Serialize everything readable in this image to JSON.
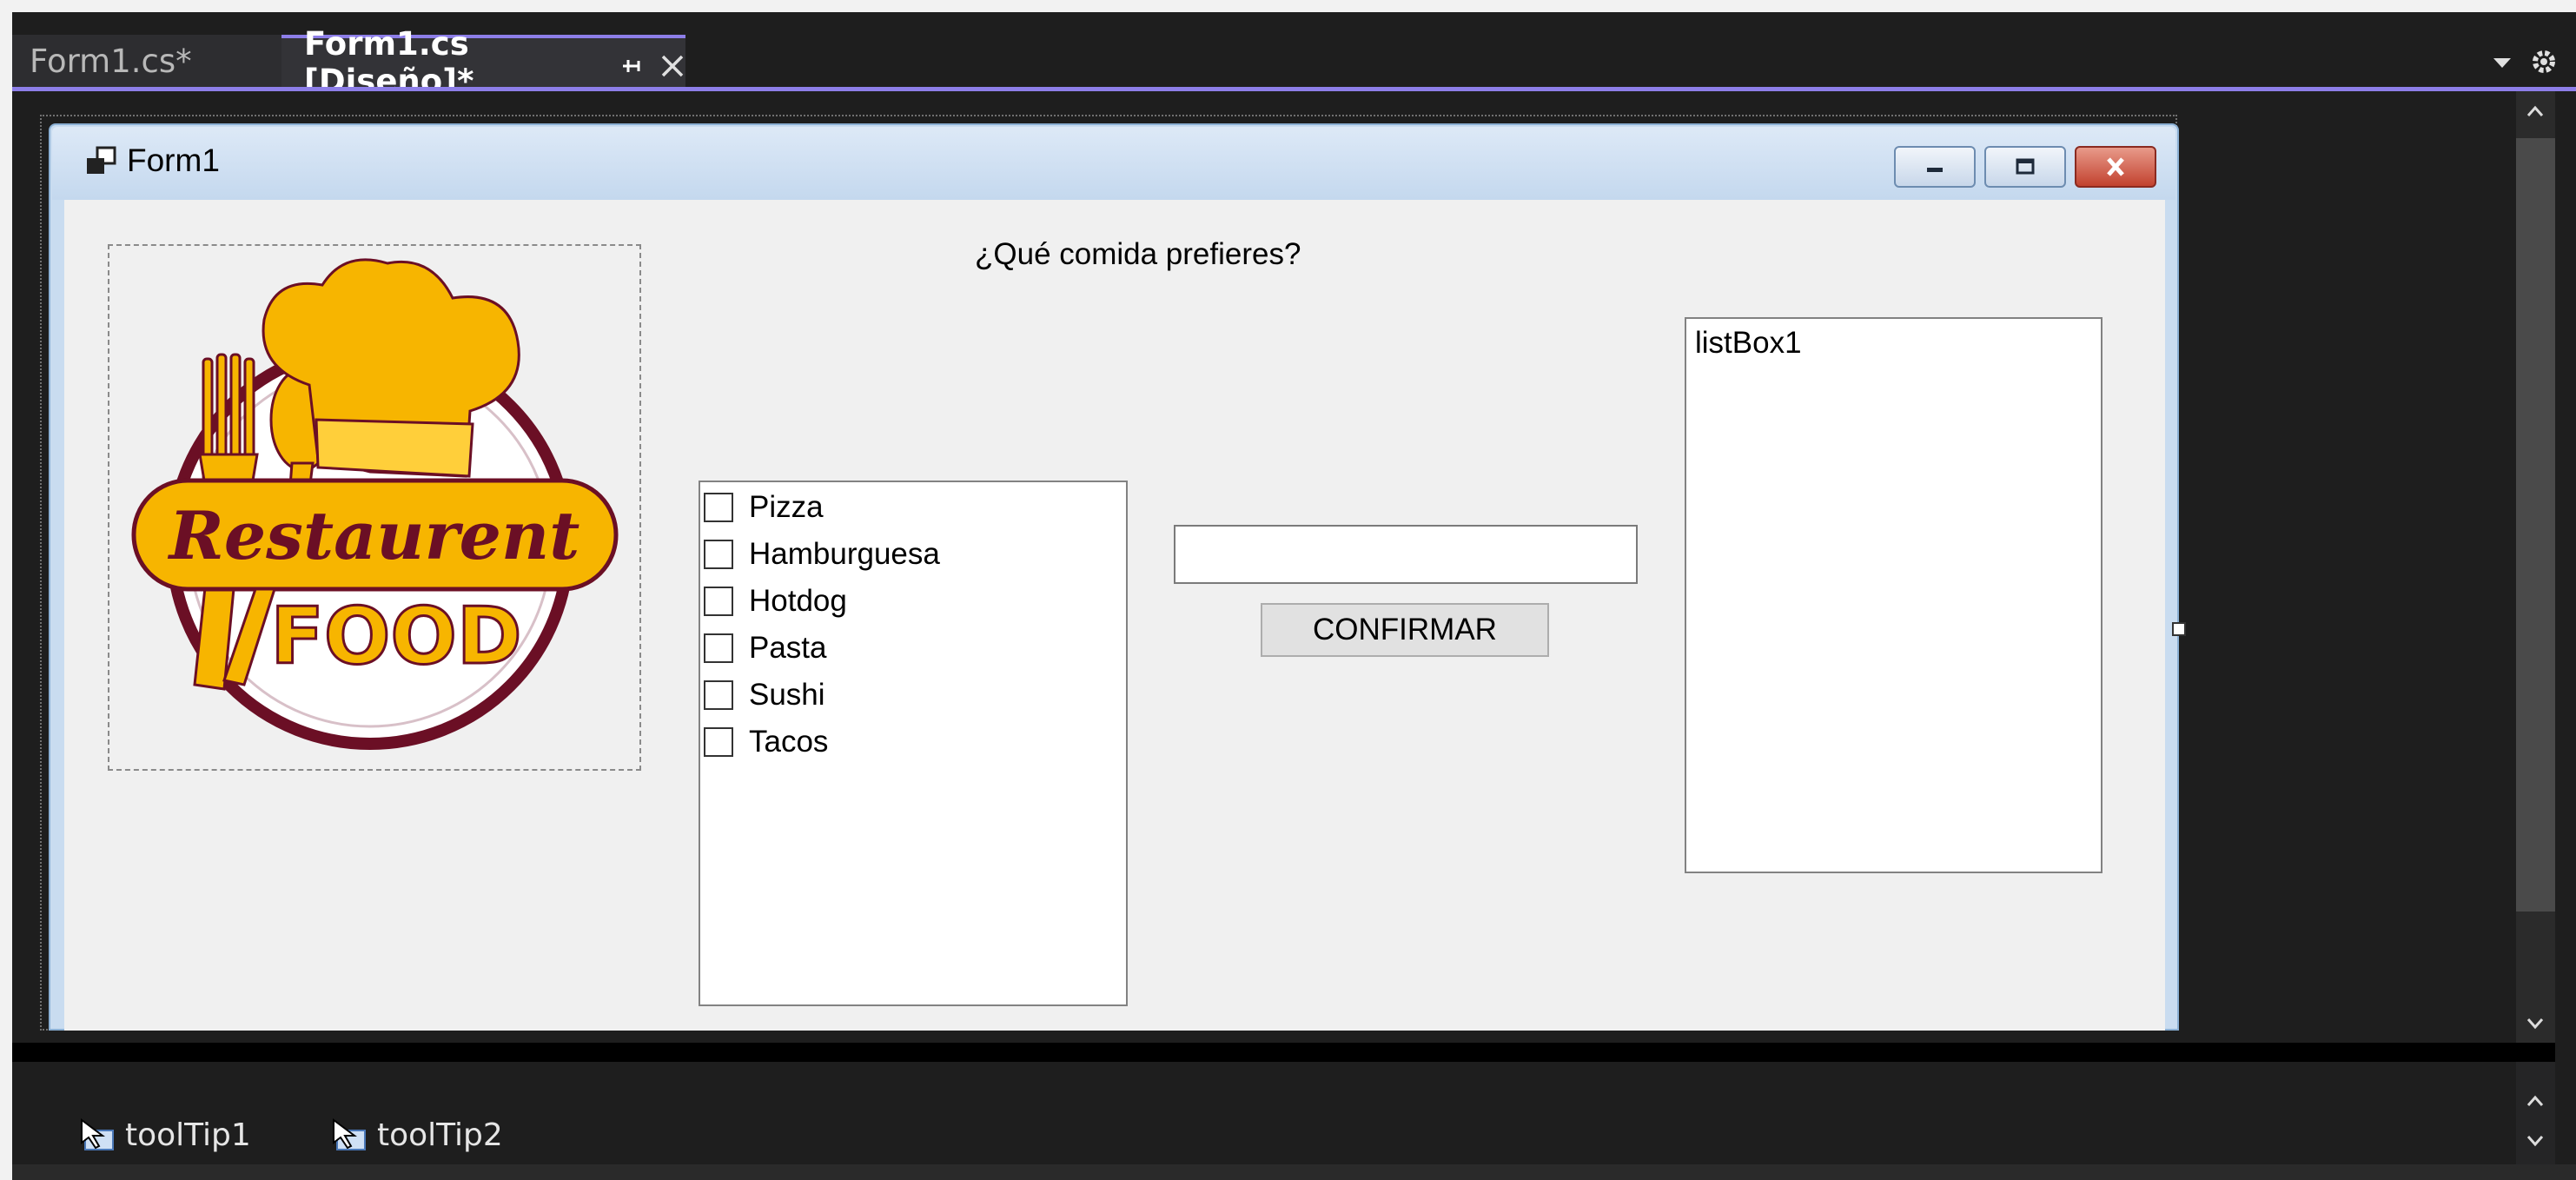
{
  "tabs": [
    {
      "label": "Form1.cs*"
    },
    {
      "label": "Form1.cs [Diseño]*"
    }
  ],
  "form": {
    "title": "Form1",
    "question": "¿Qué comida prefieres?",
    "logo": {
      "top_text": "Restaurent",
      "bottom_text": "FOOD"
    },
    "checklist": [
      {
        "label": "Pizza",
        "checked": false
      },
      {
        "label": "Hamburguesa",
        "checked": false
      },
      {
        "label": "Hotdog",
        "checked": false
      },
      {
        "label": "Pasta",
        "checked": false
      },
      {
        "label": "Sushi",
        "checked": false
      },
      {
        "label": "Tacos",
        "checked": false
      }
    ],
    "textbox_value": "",
    "confirm_label": "CONFIRMAR",
    "listbox_item": "listBox1"
  },
  "tray": {
    "items": [
      {
        "label": "toolTip1"
      },
      {
        "label": "toolTip2"
      }
    ]
  },
  "colors": {
    "accent": "#8d7ee8",
    "logo_yellow": "#f7b500",
    "logo_maroon": "#6b0f25"
  }
}
